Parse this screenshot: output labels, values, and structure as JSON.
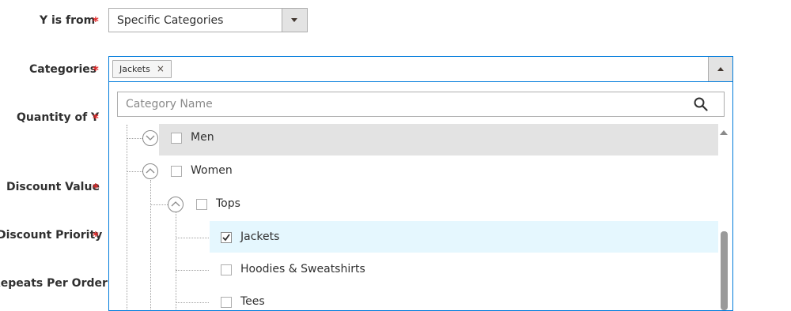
{
  "form": {
    "labels": {
      "y_is_from": "Y is from",
      "categories": "Categories",
      "quantity_of_y": "Quantity of Y",
      "discount_value": "Discount Value",
      "discount_priority": "Discount Priority",
      "repeats_per_order": "Repeats Per Order"
    },
    "required_mark": "*",
    "y_is_from_value": "Specific Categories"
  },
  "categories": {
    "selected_chip": "Jackets",
    "chip_remove": "×",
    "search_placeholder": "Category Name",
    "tree": [
      {
        "label": "Men",
        "level": 1,
        "expanded": false,
        "checked": false,
        "highlight": "hover"
      },
      {
        "label": "Women",
        "level": 1,
        "expanded": true,
        "checked": false
      },
      {
        "label": "Tops",
        "level": 2,
        "expanded": true,
        "checked": false
      },
      {
        "label": "Jackets",
        "level": 3,
        "checked": true,
        "highlight": "selected"
      },
      {
        "label": "Hoodies & Sweatshirts",
        "level": 3,
        "checked": false
      },
      {
        "label": "Tees",
        "level": 3,
        "checked": false
      }
    ]
  },
  "colors": {
    "accent": "#007bdb",
    "required": "#e22626",
    "row_hover": "#e3e3e3",
    "row_selected": "#e5f7fe"
  },
  "icons": [
    "chevron-down-icon",
    "chevron-up-icon",
    "search-icon",
    "close-icon",
    "checkmark-icon"
  ]
}
